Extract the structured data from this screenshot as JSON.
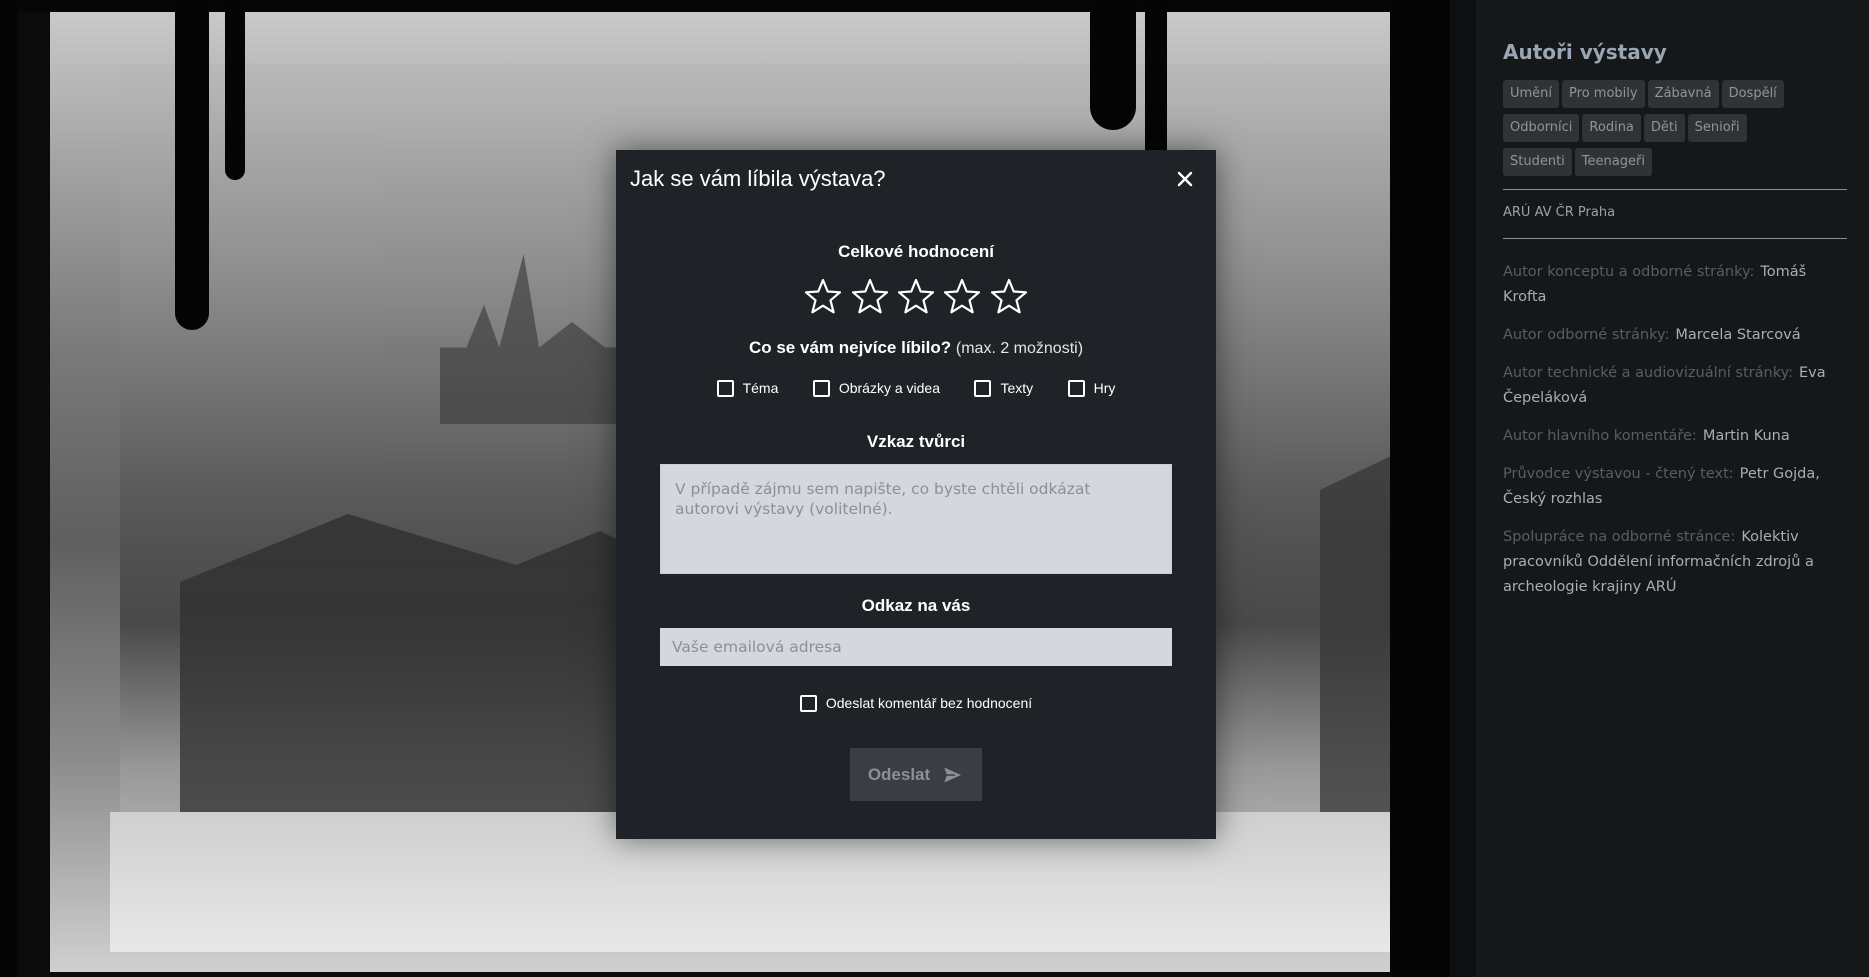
{
  "modal": {
    "title": "Jak se vám líbila výstava?",
    "close_icon": "close-icon",
    "rating_heading": "Celkové hodnocení",
    "rating_value": 0,
    "rating_max": 5,
    "liked_heading": "Co se vám nejvíce líbilo?",
    "liked_hint": "(max. 2 možnosti)",
    "liked_options": [
      "Téma",
      "Obrázky a videa",
      "Texty",
      "Hry"
    ],
    "message_heading": "Vzkaz tvůrci",
    "message_placeholder": "V případě zájmu sem napište, co byste chtěli odkázat autorovi výstavy (volitelné).",
    "contact_heading": "Odkaz na vás",
    "email_placeholder": "Vaše emailová adresa",
    "no_rating_label": "Odeslat komentář bez hodnocení",
    "submit_label": "Odeslat",
    "submit_icon": "send-icon"
  },
  "sidebar": {
    "title": "Autoři výstavy",
    "tags": [
      "Umění",
      "Pro mobily",
      "Zábavná",
      "Dospělí",
      "Odborníci",
      "Rodina",
      "Děti",
      "Senioři",
      "Studenti",
      "Teenageři"
    ],
    "organization": "ARÚ AV ČR Praha",
    "credits": [
      {
        "label": "Autor konceptu a odborné stránky:",
        "value": "Tomáš Krofta"
      },
      {
        "label": "Autor odborné stránky:",
        "value": "Marcela Starcová"
      },
      {
        "label": "Autor technické a audiovizuální stránky:",
        "value": "Eva Čepeláková"
      },
      {
        "label": "Autor hlavního komentáře:",
        "value": "Martin Kuna"
      },
      {
        "label": "Průvodce výstavou - čtený text:",
        "value": "Petr Gojda, Český rozhlas"
      },
      {
        "label": "Spolupráce na odborné stránce:",
        "value": "Kolektiv pracovníků Oddělení informačních zdrojů a archeologie krajiny ARÚ"
      }
    ]
  },
  "colors": {
    "modal_bg": "#1f2226",
    "sidebar_bg": "#161719",
    "tag_bg": "#303236",
    "input_bg": "#d4d7dc",
    "button_disabled_bg": "#3a3d43"
  }
}
